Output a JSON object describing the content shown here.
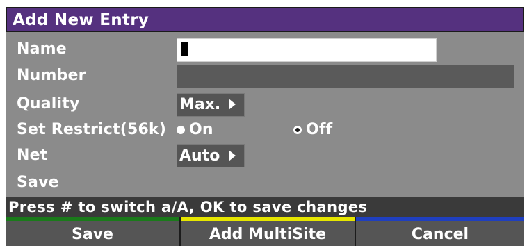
{
  "dialog": {
    "title": "Add New Entry"
  },
  "fields": {
    "name_label": "Name",
    "name_value": "",
    "number_label": "Number",
    "number_value": "",
    "quality_label": "Quality",
    "quality_value": "Max.",
    "set_restrict_label": "Set Restrict(56k)",
    "set_restrict_options": [
      "On",
      "Off"
    ],
    "set_restrict_selected": "Off",
    "net_label": "Net",
    "net_value": "Auto",
    "save_label": "Save"
  },
  "status": {
    "text": "Press # to switch a/A, OK to save changes"
  },
  "softkeys": [
    {
      "label": "Save",
      "color": "#1a7a1a"
    },
    {
      "label": "Add MultiSite",
      "color": "#e6e600"
    },
    {
      "label": "Cancel",
      "color": "#1f3fbf"
    }
  ],
  "colors": {
    "title_bar": "#55317f",
    "panel": "#8b8b8b",
    "status_bar": "#3a3a3a",
    "softkey_bg": "#555555"
  },
  "icons": {
    "select_arrow": "triangle-right-icon",
    "cursor": "text-cursor-icon",
    "radio": "radio-icon"
  }
}
